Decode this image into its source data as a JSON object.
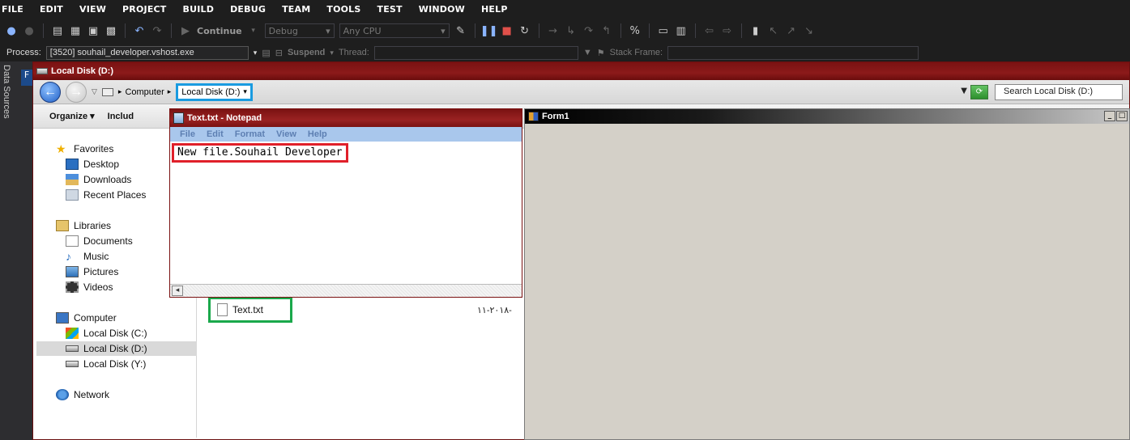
{
  "menu": [
    "FILE",
    "EDIT",
    "VIEW",
    "PROJECT",
    "BUILD",
    "DEBUG",
    "TEAM",
    "TOOLS",
    "TEST",
    "WINDOW",
    "HELP"
  ],
  "toolbar": {
    "continue_label": "Continue",
    "config": "Debug",
    "platform": "Any CPU"
  },
  "process_bar": {
    "process_label": "Process:",
    "process_value": "[3520] souhail_developer.vshost.exe",
    "suspend_label": "Suspend",
    "thread_label": "Thread:",
    "stack_frame_label": "Stack Frame:"
  },
  "left_tabs": {
    "data_sources": "Data Sources",
    "f_tab": "F"
  },
  "explorer": {
    "title": "Local Disk (D:)",
    "breadcrumb": {
      "computer": "Computer",
      "current": "Local Disk (D:)"
    },
    "search_placeholder": "Search Local Disk (D:)",
    "commands": {
      "organize": "Organize ▾",
      "include": "Includ"
    },
    "nav": {
      "favorites": "Favorites",
      "desktop": "Desktop",
      "downloads": "Downloads",
      "recent_places": "Recent Places",
      "libraries": "Libraries",
      "documents": "Documents",
      "music": "Music",
      "pictures": "Pictures",
      "videos": "Videos",
      "computer": "Computer",
      "local_c": "Local Disk (C:)",
      "local_d": "Local Disk (D:)",
      "local_y": "Local Disk (Y:)",
      "network": "Network"
    },
    "file": {
      "name": "Text.txt",
      "date": "٢٠١٨-١١-"
    }
  },
  "notepad": {
    "title": "Text.txt - Notepad",
    "menu": [
      "File",
      "Edit",
      "Format",
      "View",
      "Help"
    ],
    "content": "New file.Souhail Developer"
  },
  "form1": {
    "title": "Form1"
  }
}
